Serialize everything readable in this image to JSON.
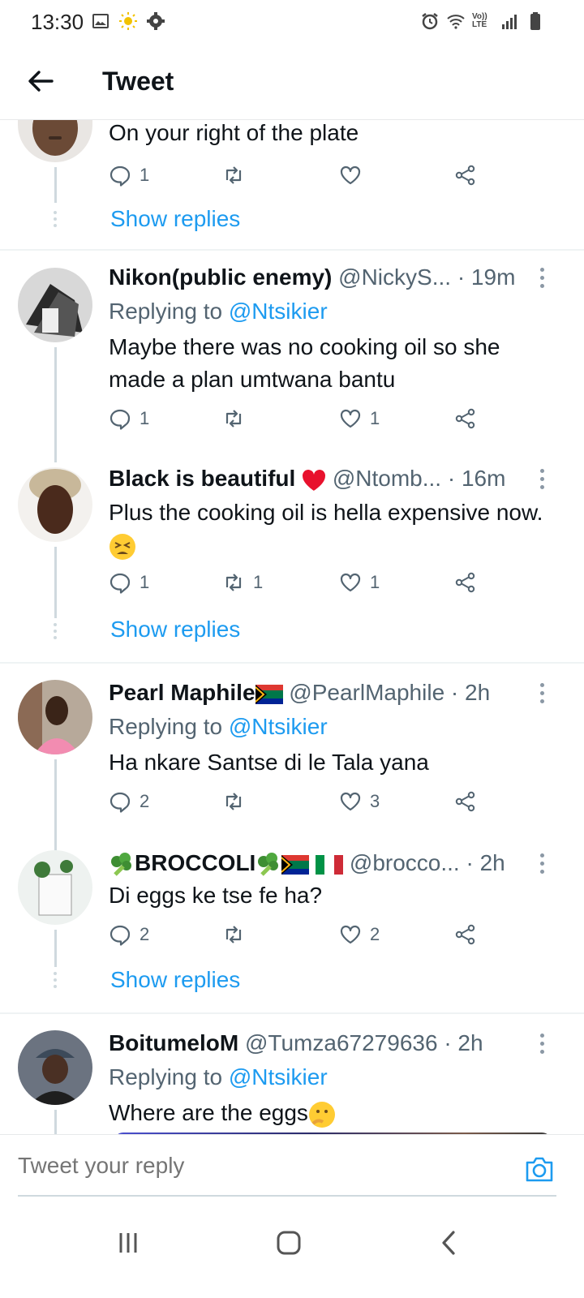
{
  "status_bar": {
    "time": "13:30",
    "volte_label": "Vo)) LTE"
  },
  "header": {
    "title": "Tweet"
  },
  "tweets": [
    {
      "text": "On your right of the plate",
      "replies": "1",
      "retweets": "",
      "likes": "",
      "show_replies": "Show replies"
    },
    {
      "name": "Nikon(public enemy)",
      "handle": "@NickyS...",
      "time": "· 19m",
      "replying_prefix": "Replying to",
      "replying_to": "@Ntsikier",
      "text": "Maybe there was no cooking oil so she made a plan umtwana bantu",
      "replies": "1",
      "retweets": "",
      "likes": "1"
    },
    {
      "name": "Black is beautiful",
      "handle": "@Ntomb...",
      "time": "· 16m",
      "text": "Plus the cooking oil is hella expensive now.",
      "replies": "1",
      "retweets": "1",
      "likes": "1",
      "show_replies": "Show replies"
    },
    {
      "name": "Pearl Maphile",
      "handle": "@PearlMaphile",
      "time": "· 2h",
      "replying_prefix": "Replying to",
      "replying_to": "@Ntsikier",
      "text": "Ha nkare Santse di le Tala yana",
      "replies": "2",
      "retweets": "",
      "likes": "3"
    },
    {
      "name": "BROCCOLI",
      "handle": "@brocco...",
      "time": "· 2h",
      "text": "Di eggs ke tse fe ha?",
      "replies": "2",
      "retweets": "",
      "likes": "2",
      "show_replies": "Show replies"
    },
    {
      "name": "BoitumeloM",
      "handle": "@Tumza67279636",
      "time": "· 2h",
      "replying_prefix": "Replying to",
      "replying_to": "@Ntsikier",
      "text": "Where are the eggs"
    }
  ],
  "composer": {
    "placeholder": "Tweet your reply"
  },
  "colors": {
    "link": "#1d9bf0",
    "secondary_text": "#536471",
    "divider": "#eff3f4"
  }
}
